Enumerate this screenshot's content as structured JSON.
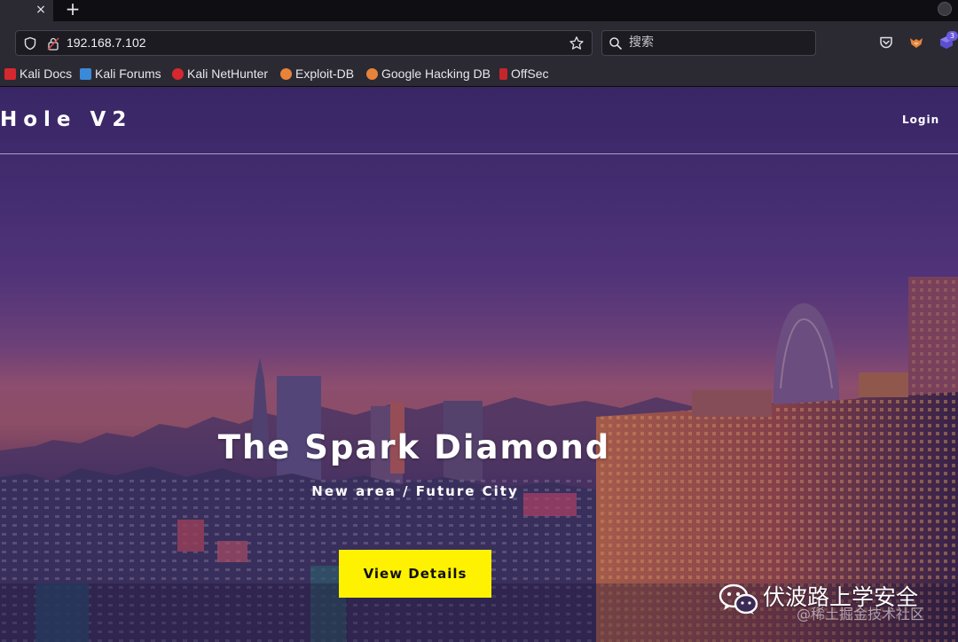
{
  "browser": {
    "tab_close_glyph": "×",
    "new_tab_glyph": "+",
    "url": "192.168.7.102",
    "search_placeholder": "搜索",
    "extension_badge": "3"
  },
  "bookmarks": [
    {
      "label": "Kali Docs",
      "color": "#d6282e"
    },
    {
      "label": "Kali Forums",
      "color": "#3b8ad8"
    },
    {
      "label": "Kali NetHunter",
      "color": "#d6282e"
    },
    {
      "label": "Exploit-DB",
      "color": "#e8833a"
    },
    {
      "label": "Google Hacking DB",
      "color": "#e8833a"
    },
    {
      "label": "OffSec",
      "color": "#c4262b"
    }
  ],
  "site": {
    "brand": "Hole V2",
    "login": "Login",
    "hero_title": "The Spark Diamond",
    "hero_subtitle": "New area / Future City",
    "cta": "View Details",
    "cta_color": "#fff200"
  },
  "watermark": {
    "main": "伏波路上学安全",
    "sub": "@稀土掘金技术社区"
  }
}
